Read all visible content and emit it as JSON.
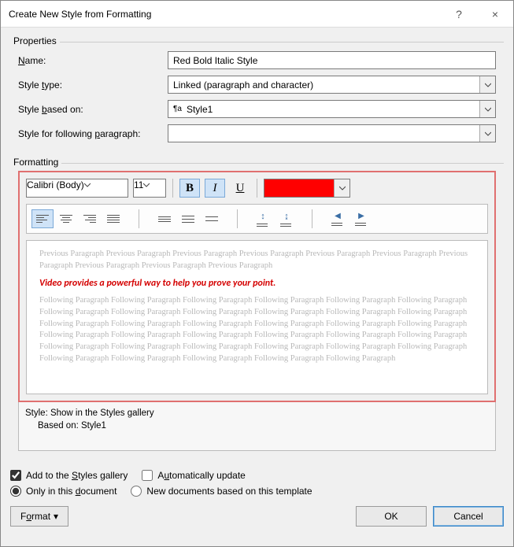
{
  "titlebar": {
    "title": "Create New Style from Formatting",
    "help": "?",
    "close": "×"
  },
  "properties": {
    "group_label": "Properties",
    "name_label_pre": "",
    "name_label_key": "N",
    "name_label_post": "ame:",
    "name_value": "Red Bold Italic Style",
    "styletype_label_pre": "Style ",
    "styletype_label_key": "t",
    "styletype_label_post": "ype:",
    "styletype_value": "Linked (paragraph and character)",
    "basedon_label_pre": "Style ",
    "basedon_label_key": "b",
    "basedon_label_post": "ased on:",
    "basedon_pilcrow": "¶a",
    "basedon_value": "Style1",
    "following_label_pre": "Style for following ",
    "following_label_key": "p",
    "following_label_post": "aragraph:",
    "following_value": ""
  },
  "formatting": {
    "group_label": "Formatting",
    "font_name": "Calibri (Body)",
    "font_size": "11",
    "bold": "B",
    "italic": "I",
    "underline": "U",
    "color": "#ff0000",
    "preview_sample": "Video provides a powerful way to help you prove your point.",
    "preview_prev": "Previous Paragraph Previous Paragraph Previous Paragraph Previous Paragraph Previous Paragraph Previous Paragraph Previous Paragraph Previous Paragraph Previous Paragraph Previous Paragraph",
    "preview_follow": "Following Paragraph Following Paragraph Following Paragraph Following Paragraph Following Paragraph Following Paragraph Following Paragraph Following Paragraph Following Paragraph Following Paragraph Following Paragraph Following Paragraph Following Paragraph Following Paragraph Following Paragraph Following Paragraph Following Paragraph Following Paragraph Following Paragraph Following Paragraph Following Paragraph Following Paragraph Following Paragraph Following Paragraph Following Paragraph Following Paragraph Following Paragraph Following Paragraph Following Paragraph Following Paragraph Following Paragraph Following Paragraph Following Paragraph Following Paragraph Following Paragraph",
    "style_desc_line1": "Style: Show in the Styles gallery",
    "style_desc_line2": "Based on: Style1"
  },
  "checks": {
    "add_gallery_pre": "Add to the ",
    "add_gallery_key": "S",
    "add_gallery_post": "tyles gallery",
    "auto_update_pre": "A",
    "auto_update_key": "u",
    "auto_update_post": "tomatically update",
    "only_doc_pre": "Only in this ",
    "only_doc_key": "d",
    "only_doc_post": "ocument",
    "new_docs": "New documents based on this template",
    "add_gallery_checked": true,
    "auto_update_checked": false,
    "only_doc_selected": true,
    "new_docs_selected": false
  },
  "buttons": {
    "format_pre": "F",
    "format_key": "o",
    "format_post": "rmat",
    "ok": "OK",
    "cancel": "Cancel"
  }
}
